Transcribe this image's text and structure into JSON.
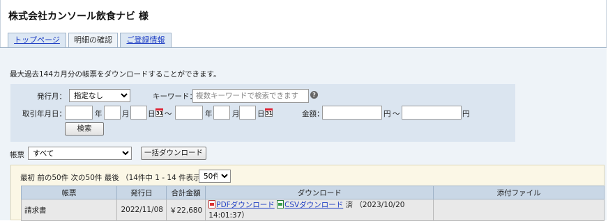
{
  "header": {
    "company": "株式会社カンソール飲食ナビ 様"
  },
  "tabs": [
    {
      "label": "トップページ",
      "active": false
    },
    {
      "label": "明細の確認",
      "active": true
    },
    {
      "label": "ご登録情報",
      "active": false
    }
  ],
  "notice": "最大過去144カ月分の帳票をダウンロードすることができます。",
  "search": {
    "issue_month_label": "発行月：",
    "issue_month_value": "指定なし",
    "keyword_label": "キーワード：",
    "keyword_placeholder": "複数キーワードで検索できます",
    "keyword_value": "",
    "date_label": "取引年月日：",
    "year_unit": "年",
    "month_unit": "月",
    "day_unit": "日",
    "tilde": "～",
    "amount_label": "金額：",
    "yen_unit": "円",
    "search_button": "検索",
    "calendar_glyph": "31"
  },
  "doctype": {
    "label": "帳票",
    "value": "すべて",
    "bulk_download_button": "一括ダウンロード"
  },
  "pager": {
    "text": "最初 前の50件 次の50件 最後 （14件中 1 - 14 件表示）",
    "per_page": "50件"
  },
  "table": {
    "columns": [
      "帳票",
      "発行日",
      "合計金額",
      "ダウンロード",
      "添付ファイル"
    ],
    "rows": [
      {
        "type": "請求書",
        "date": "2022/11/08",
        "amount": "￥22,680",
        "pdf_link": "PDFダウンロード",
        "csv_link": "CSVダウンロード",
        "status": "済 （2023/10/20 14:01:37）",
        "attachment": ""
      }
    ]
  }
}
